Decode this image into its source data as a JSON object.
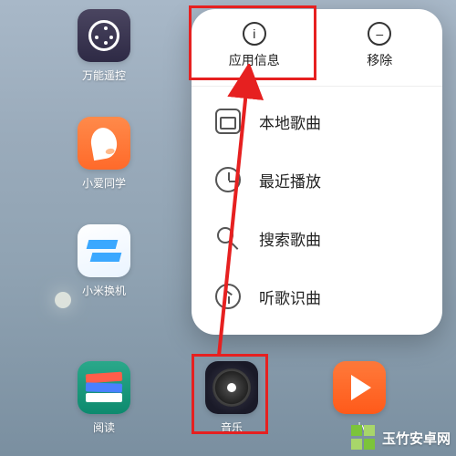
{
  "home": {
    "apps": {
      "remote": {
        "label": "万能遥控"
      },
      "xiaoai": {
        "label": "小爱同学"
      },
      "switch": {
        "label": "小米换机"
      },
      "reader": {
        "label": "阅读"
      },
      "music": {
        "label": "音乐"
      },
      "video": {
        "label": "小"
      }
    }
  },
  "popup": {
    "header": {
      "info": {
        "label": "应用信息",
        "icon": "info-icon"
      },
      "remove": {
        "label": "移除",
        "icon": "remove-icon"
      }
    },
    "items": [
      {
        "label": "本地歌曲",
        "icon": "folder-icon"
      },
      {
        "label": "最近播放",
        "icon": "clock-icon"
      },
      {
        "label": "搜索歌曲",
        "icon": "search-icon"
      },
      {
        "label": "听歌识曲",
        "icon": "recognize-icon"
      }
    ]
  },
  "watermark": {
    "text": "玉竹安卓网"
  },
  "colors": {
    "annotation": "#e62020",
    "accent": "#7cc43a"
  }
}
